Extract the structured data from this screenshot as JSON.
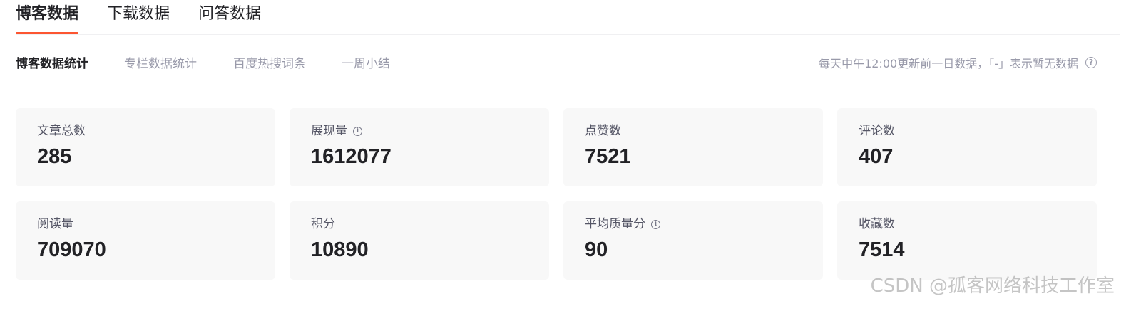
{
  "colors": {
    "accent": "#fc5531",
    "card_bg": "#f8f8f8",
    "muted_text": "#999aaa"
  },
  "top_tabs": [
    {
      "label": "博客数据",
      "active": true
    },
    {
      "label": "下载数据",
      "active": false
    },
    {
      "label": "问答数据",
      "active": false
    }
  ],
  "sub_tabs": [
    {
      "label": "博客数据统计",
      "active": true
    },
    {
      "label": "专栏数据统计",
      "active": false
    },
    {
      "label": "百度热搜词条",
      "active": false
    },
    {
      "label": "一周小结",
      "active": false
    }
  ],
  "update_note": "每天中午12:00更新前一日数据，「-」表示暂无数据",
  "help_icon": "question-circle-icon",
  "stats": [
    {
      "label": "文章总数",
      "value": "285",
      "has_info": false
    },
    {
      "label": "展现量",
      "value": "1612077",
      "has_info": true
    },
    {
      "label": "点赞数",
      "value": "7521",
      "has_info": false
    },
    {
      "label": "评论数",
      "value": "407",
      "has_info": false
    },
    {
      "label": "阅读量",
      "value": "709070",
      "has_info": false
    },
    {
      "label": "积分",
      "value": "10890",
      "has_info": false
    },
    {
      "label": "平均质量分",
      "value": "90",
      "has_info": true
    },
    {
      "label": "收藏数",
      "value": "7514",
      "has_info": false
    }
  ],
  "watermark": "CSDN @孤客网络科技工作室"
}
